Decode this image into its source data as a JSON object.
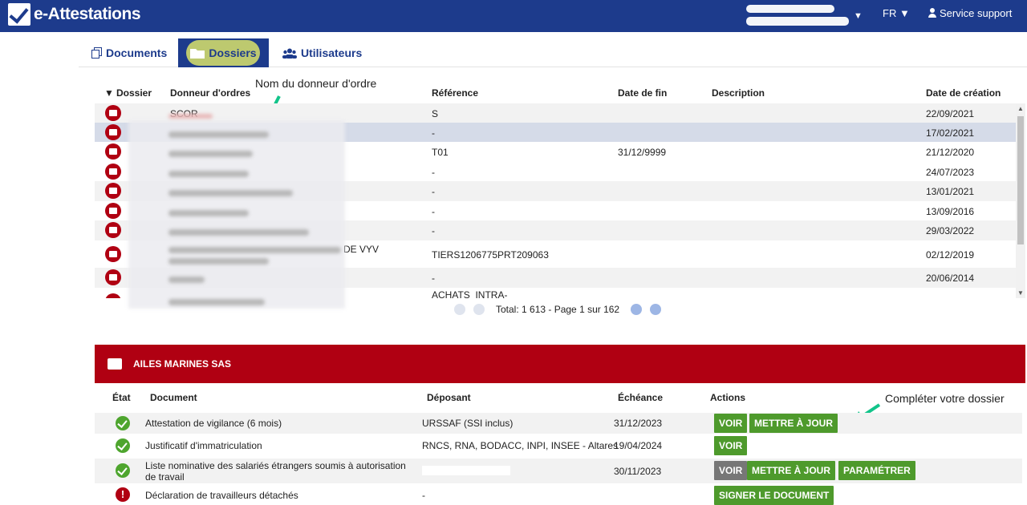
{
  "app": {
    "logo_text": "e-Attestations",
    "lang": "FR ▼",
    "support": "Service support",
    "user_caret": "▼"
  },
  "tabs": {
    "documents": "Documents",
    "dossiers": "Dossiers",
    "utilisateurs": "Utilisateurs"
  },
  "annotations": {
    "donneur": "Nom du donneur d'ordre",
    "completer": "Compléter votre dossier"
  },
  "table": {
    "headers": {
      "dossier": "Dossier",
      "donneur": "Donneur d'ordres",
      "reference": "Référence",
      "date_fin": "Date de fin",
      "description": "Description",
      "date_creation": "Date de création"
    },
    "sort_caret": "▼",
    "rows": [
      {
        "donneur": "SCOR",
        "reference": "S",
        "date_fin": "",
        "date_creation": "22/09/2021"
      },
      {
        "donneur": "",
        "reference": "-",
        "date_fin": "",
        "date_creation": "17/02/2021"
      },
      {
        "donneur": "",
        "reference": "T01",
        "date_fin": "31/12/9999",
        "date_creation": "21/12/2020"
      },
      {
        "donneur": "",
        "reference": "-",
        "date_fin": "",
        "date_creation": "24/07/2023"
      },
      {
        "donneur": "",
        "reference": "-",
        "date_fin": "",
        "date_creation": "13/01/2021"
      },
      {
        "donneur": "",
        "reference": "-",
        "date_fin": "",
        "date_creation": "13/09/2016"
      },
      {
        "donneur": "",
        "reference": "-",
        "date_fin": "",
        "date_creation": "29/03/2022"
      },
      {
        "donneur": "DE VYV",
        "reference": "TIERS1206775PRT209063",
        "date_fin": "",
        "date_creation": "02/12/2019"
      },
      {
        "donneur": "",
        "reference": "-",
        "date_fin": "",
        "date_creation": "20/06/2014"
      },
      {
        "donneur": "",
        "reference": "ACHATS_INTRA-",
        "date_fin": "",
        "date_creation": ""
      }
    ]
  },
  "pager": {
    "total": "Total: 1 613 - Page 1 sur 162"
  },
  "panel": {
    "title": "AILES MARINES SAS",
    "headers": {
      "etat": "État",
      "document": "Document",
      "deposant": "Déposant",
      "echeance": "Échéance",
      "actions": "Actions"
    },
    "rows": [
      {
        "document": "Attestation de vigilance (6 mois)",
        "deposant": "URSSAF (SSI inclus)",
        "echeance": "31/12/2023"
      },
      {
        "document": "Justificatif d'immatriculation",
        "deposant": "RNCS, RNA, BODACC, INPI, INSEE - Altares",
        "echeance": "19/04/2024"
      },
      {
        "document": "Liste nominative des salariés étrangers soumis à autorisation de travail",
        "deposant": "",
        "echeance": "30/11/2023"
      },
      {
        "document": "Déclaration de travailleurs détachés",
        "deposant": "-",
        "echeance": ""
      }
    ],
    "buttons": {
      "voir": "VOIR",
      "maj": "METTRE À JOUR",
      "parametrer": "PARAMÉTRER",
      "signer": "SIGNER LE DOCUMENT"
    }
  },
  "colors": {
    "brand": "#1d3b8c",
    "alert": "#b00012",
    "ok": "#4ea52e",
    "action": "#4e9a2c"
  }
}
